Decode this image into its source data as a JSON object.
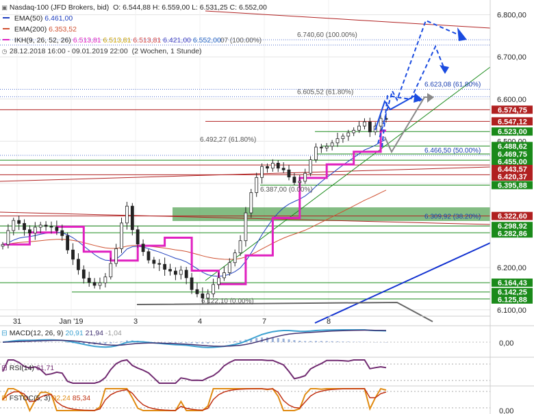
{
  "header": {
    "instrument": "Nasdaq-100 (JFD Brokers, bid)",
    "ohlc": "O: 6.544,88  H: 6.559,00  L: 6.531,25  C: 6.552,00",
    "ema50_label": "EMA(50)",
    "ema50_value": "6.461,00",
    "ema200_label": "EMA(200)",
    "ema200_value": "6.353,52",
    "ikh_label": "IKH(9, 26, 52, 26)",
    "ikh_values": [
      "6.513,81",
      "6.513,81",
      "6.513,81",
      "6.421,00",
      "6.552,00"
    ],
    "date_range": "28.12.2018 16:00 - 09.01.2019 22:00",
    "period": "(2 Wochen, 1 Stunde)"
  },
  "colors": {
    "ema50": "#1f3fbf",
    "ema200": "#d05030",
    "ikh": "#e020c0",
    "ikh_values": [
      "#e020c0",
      "#c8a000",
      "#d04040",
      "#4040c0",
      "#2060c0"
    ],
    "green_level": "#1a8a1a",
    "red_level": "#b02020",
    "blue_trend": "#1030d0",
    "forecast": "#1a4be0",
    "zone": "#5aa55a"
  },
  "chart_data": [
    {
      "type": "candlestick",
      "panel": "price",
      "x_ticks": [
        "31",
        "Jan '19",
        "3",
        "4",
        "7",
        "8"
      ],
      "y_ticks": [
        "6.800,00",
        "6.700,00",
        "6.600,00",
        "6.500,00",
        "6.400,00",
        "6.300,00",
        "6.200,00",
        "6.100,00"
      ],
      "ylim": [
        6085,
        6835
      ],
      "price_tags": [
        {
          "label": "6.574,75",
          "value": 6574.75,
          "color": "#b02020"
        },
        {
          "label": "6.547,12",
          "value": 6547.12,
          "color": "#b02020"
        },
        {
          "label": "6.523,00",
          "value": 6523.0,
          "color": "#1a8a1a"
        },
        {
          "label": "6.488,62",
          "value": 6488.62,
          "color": "#1a8a1a"
        },
        {
          "label": "6.469,75",
          "value": 6469.75,
          "color": "#1a8a1a"
        },
        {
          "label": "6.455,00",
          "value": 6455.0,
          "color": "#1a8a1a"
        },
        {
          "label": "6.443,57",
          "value": 6443.57,
          "color": "#b02020"
        },
        {
          "label": "6.420,37",
          "value": 6420.37,
          "color": "#b02020"
        },
        {
          "label": "6.395,88",
          "value": 6395.88,
          "color": "#1a8a1a"
        },
        {
          "label": "6.322,60",
          "value": 6322.6,
          "color": "#b02020"
        },
        {
          "label": "6.298,92",
          "value": 6298.92,
          "color": "#1a8a1a"
        },
        {
          "label": "6.282,86",
          "value": 6282.86,
          "color": "#1a8a1a"
        },
        {
          "label": "6.164,43",
          "value": 6164.43,
          "color": "#1a8a1a"
        },
        {
          "label": "6.142,25",
          "value": 6142.25,
          "color": "#1a8a1a"
        },
        {
          "label": "6.125,88",
          "value": 6125.88,
          "color": "#1a8a1a"
        }
      ],
      "fib_annotations": [
        {
          "label": "6.740,60 (100.00%)",
          "value": 6740.6
        },
        {
          "label": "07 (100.00%)",
          "value": 6728.0
        },
        {
          "label": "6.605,52 (61.80%)",
          "value": 6605.52
        },
        {
          "label": "6.623,08 (61.80%)",
          "value": 6623.08
        },
        {
          "label": "6.492,27 (61.80%)",
          "value": 6492.27
        },
        {
          "label": "6.466,50 (50.00%)",
          "value": 6466.5
        },
        {
          "label": "6.387,00 (0.00%)",
          "value": 6387.0
        },
        {
          "label": "6.309,92 (38.20%)",
          "value": 6309.92
        },
        {
          "label": "6.122,10 (0.00%)",
          "value": 6122.1
        }
      ],
      "close_series": [
        6255,
        6288,
        6312,
        6305,
        6290,
        6282,
        6296,
        6301,
        6298,
        6296,
        6288,
        6276,
        6242,
        6220,
        6195,
        6175,
        6165,
        6158,
        6164,
        6178,
        6210,
        6245,
        6306,
        6346,
        6290,
        6256,
        6238,
        6218,
        6210,
        6208,
        6196,
        6192,
        6184,
        6194,
        6176,
        6148,
        6138,
        6128,
        6138,
        6160,
        6176,
        6188,
        6212,
        6235,
        6264,
        6330,
        6378,
        6414,
        6440,
        6436,
        6448,
        6436,
        6432,
        6415,
        6402,
        6405,
        6424,
        6456,
        6486,
        6484,
        6488,
        6496,
        6506,
        6512,
        6520,
        6526,
        6536,
        6546,
        6522,
        6536,
        6554,
        6552
      ]
    },
    {
      "type": "line",
      "panel": "macd",
      "label": "MACD(12, 26, 9)",
      "values_text": [
        "20,91",
        "21,94",
        "-1,04"
      ],
      "y_ticks": [
        "0,00"
      ]
    },
    {
      "type": "line",
      "panel": "rsi",
      "label": "RSI(14)",
      "values_text": [
        "61,71"
      ]
    },
    {
      "type": "line",
      "panel": "fstoc",
      "label": "FSTOC(5, 3)",
      "values_text": [
        "92,24",
        "85,34"
      ],
      "y_ticks": [
        "0,00"
      ]
    }
  ]
}
